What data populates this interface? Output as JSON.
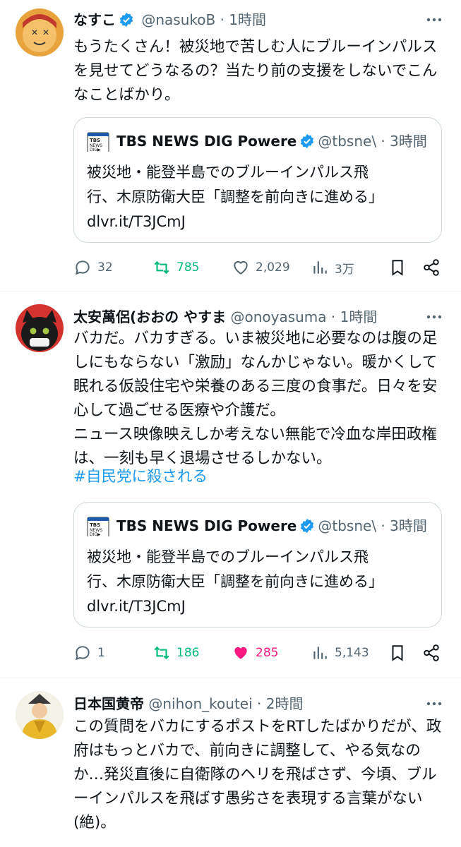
{
  "tweets": [
    {
      "name": "なすこ",
      "handle": "@nasukoB",
      "sep": "·",
      "time": "1時間",
      "text": "もうたくさん！被災地で苦しむ人にブルーインパルスを見せてどうなるの？当たり前の支援をしないでこんなことばかり。",
      "quote": {
        "name": "TBS NEWS DIG Powere",
        "handle": "@tbsne\\",
        "sep": "·",
        "time": "3時間",
        "line1": "被災地・能登半島でのブルーインパルス飛",
        "line2": "行、木原防衛大臣「調整を前向きに進める」",
        "link": "dlvr.it/T3JCmJ"
      },
      "replies": "32",
      "retweets": "785",
      "likes": "2,029",
      "views": "3万",
      "liked": false
    },
    {
      "name": "太安萬侶(おおの やすま",
      "handle": "@onoyasuma",
      "sep": "·",
      "time": "1時間",
      "text": "バカだ。バカすぎる。いま被災地に必要なのは腹の足しにもならない「激励」なんかじゃない。暖かくして眠れる仮設住宅や栄養のある三度の食事だ。日々を安心して過ごせる医療や介護だ。\nニュース映像映えしか考えない無能で冷血な岸田政権は、一刻も早く退場させるしかない。",
      "hashtag": "#自民党に殺される",
      "quote": {
        "name": "TBS NEWS DIG Powere",
        "handle": "@tbsne\\",
        "sep": "·",
        "time": "3時間",
        "line1": "被災地・能登半島でのブルーインパルス飛",
        "line2": "行、木原防衛大臣「調整を前向きに進める」",
        "link": "dlvr.it/T3JCmJ"
      },
      "replies": "1",
      "retweets": "186",
      "likes": "285",
      "views": "5,143",
      "liked": true
    },
    {
      "name": "日本国黄帝",
      "handle": "@nihon_koutei",
      "sep": "·",
      "time": "2時間",
      "text": "この質問をバカにするポストをRTしたばかりだが、政府はもっとバカで、前向きに調整して、やる気なのか…発災直後に自衛隊のヘリを飛ばさず、今頃、ブルーインパルスを飛ばす愚劣さを表現する言葉がない(絶)。"
    }
  ],
  "colors": {
    "accent": "#1d9bf0",
    "retweet": "#00ba7c",
    "like": "#f91880",
    "muted": "#536471"
  }
}
